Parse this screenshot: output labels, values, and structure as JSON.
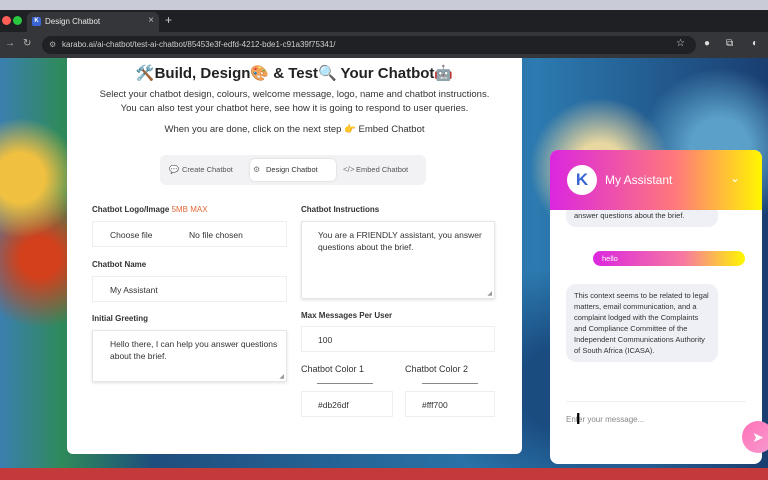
{
  "browser": {
    "tab_title": "Design Chatbot",
    "tab_close": "×",
    "new_tab": "+",
    "url": "karabo.ai/ai-chatbot/test-ai-chatbot/85453e3f-edfd-4212-bde1-c91a39f75341/",
    "favicon_letter": "K"
  },
  "page": {
    "heading": "🛠️Build, Design🎨 & Test🔍 Your Chatbot🤖",
    "desc_line1": "Select your chatbot design, colours, welcome message, logo, name and chatbot instructions.",
    "desc_line2": "You can also test your chatbot here, see how it is going to respond to user queries.",
    "desc_line3": "When you are done, click on the next step 👉 Embed Chatbot"
  },
  "steps": [
    {
      "label": "Create Chatbot",
      "icon": "chat-icon"
    },
    {
      "label": "Design Chatbot",
      "icon": "gear-icon"
    },
    {
      "label": "Embed Chatbot",
      "icon": "code-icon"
    }
  ],
  "form": {
    "logo_label": "Chatbot Logo/Image",
    "logo_hint": "5MB MAX",
    "choose_file": "Choose file",
    "no_file": "No file chosen",
    "name_label": "Chatbot Name",
    "name_value": "My Assistant",
    "greeting_label": "Initial Greeting",
    "greeting_value": "Hello there, I can help you answer questions about the brief.",
    "instructions_label": "Chatbot Instructions",
    "instructions_value": "You are a FRIENDLY assistant, you answer questions about the brief.",
    "max_label": "Max Messages Per User",
    "max_value": "100",
    "color1_label": "Chatbot Color 1",
    "color1_value": "#db26df",
    "color2_label": "Chatbot Color 2",
    "color2_value": "#fff700"
  },
  "widget": {
    "logo_letter": "K",
    "title": "My Assistant",
    "chevron": "⌄",
    "msg_bot_partial": "answer questions about the brief.",
    "msg_user": "hello",
    "msg_bot_reply": "This context seems to be related to legal matters, email communication, and a complaint lodged with the Complaints and Compliance Committee of the Independent Communications Authority of South Africa (ICASA).",
    "input_placeholder": "Enter your message...",
    "send_icon": "➤",
    "accent1": "#db26df",
    "accent2": "#fff700"
  }
}
